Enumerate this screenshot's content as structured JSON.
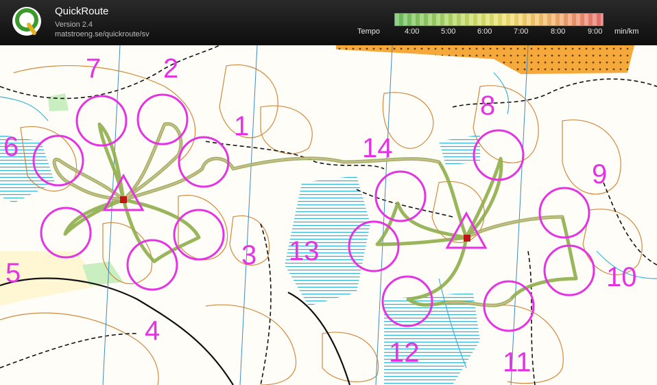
{
  "app": {
    "title": "QuickRoute",
    "version": "Version 2.4",
    "url": "matstroeng.se/quickroute/sv"
  },
  "tempo": {
    "label": "Tempo",
    "ticks": [
      "4:00",
      "5:00",
      "6:00",
      "7:00",
      "8:00",
      "9:00"
    ],
    "unit": "min/km",
    "colors": {
      "fast": "#6cc060",
      "medium": "#f3e071",
      "slow": "#ea7272"
    }
  },
  "map": {
    "control_color": "#e333e3",
    "controls": [
      {
        "label": "1"
      },
      {
        "label": "2"
      },
      {
        "label": "3"
      },
      {
        "label": "4"
      },
      {
        "label": "5"
      },
      {
        "label": "6"
      },
      {
        "label": "7"
      },
      {
        "label": "8"
      },
      {
        "label": "9"
      },
      {
        "label": "10"
      },
      {
        "label": "11"
      },
      {
        "label": "12"
      },
      {
        "label": "13"
      },
      {
        "label": "14"
      }
    ]
  }
}
